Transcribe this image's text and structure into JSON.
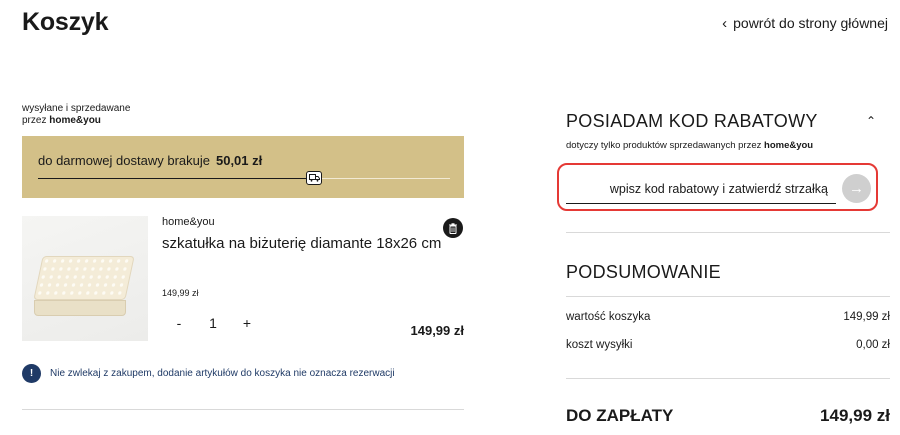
{
  "header": {
    "title": "Koszyk",
    "back_link": "powrót do strony głównej"
  },
  "cart": {
    "seller_line1": "wysyłane i sprzedawane",
    "seller_prefix": "przez",
    "seller_name": "home&you",
    "shipping": {
      "text": "do darmowej dostawy brakuje",
      "amount": "50,01 zł",
      "progress": 0.67
    },
    "item": {
      "brand": "home&you",
      "name": "szkatułka na biżuterię diamante 18x26 cm",
      "unit_price": "149,99 zł",
      "qty_minus": "-",
      "quantity": "1",
      "qty_plus": "+",
      "total": "149,99 zł"
    },
    "notice_icon": "!",
    "notice": "Nie zwlekaj z zakupem, dodanie artykułów do koszyka nie oznacza rezerwacji"
  },
  "discount": {
    "title": "POSIADAM KOD RABATOWY",
    "caret": "⌃",
    "note_prefix": "dotyczy tylko produktów sprzedawanych przez",
    "note_brand": "home&you",
    "placeholder": "wpisz kod rabatowy i zatwierdź strzałką",
    "submit_icon": "→"
  },
  "summary": {
    "title": "PODSUMOWANIE",
    "rows": [
      {
        "label": "wartość koszyka",
        "value": "149,99 zł"
      },
      {
        "label": "koszt wysyłki",
        "value": "0,00 zł"
      }
    ],
    "pay_label": "DO ZAPŁATY",
    "pay_value": "149,99 zł"
  },
  "colors": {
    "shipping_bar": "#d3c088",
    "highlight": "#e53935",
    "notice": "#1f3a66"
  }
}
